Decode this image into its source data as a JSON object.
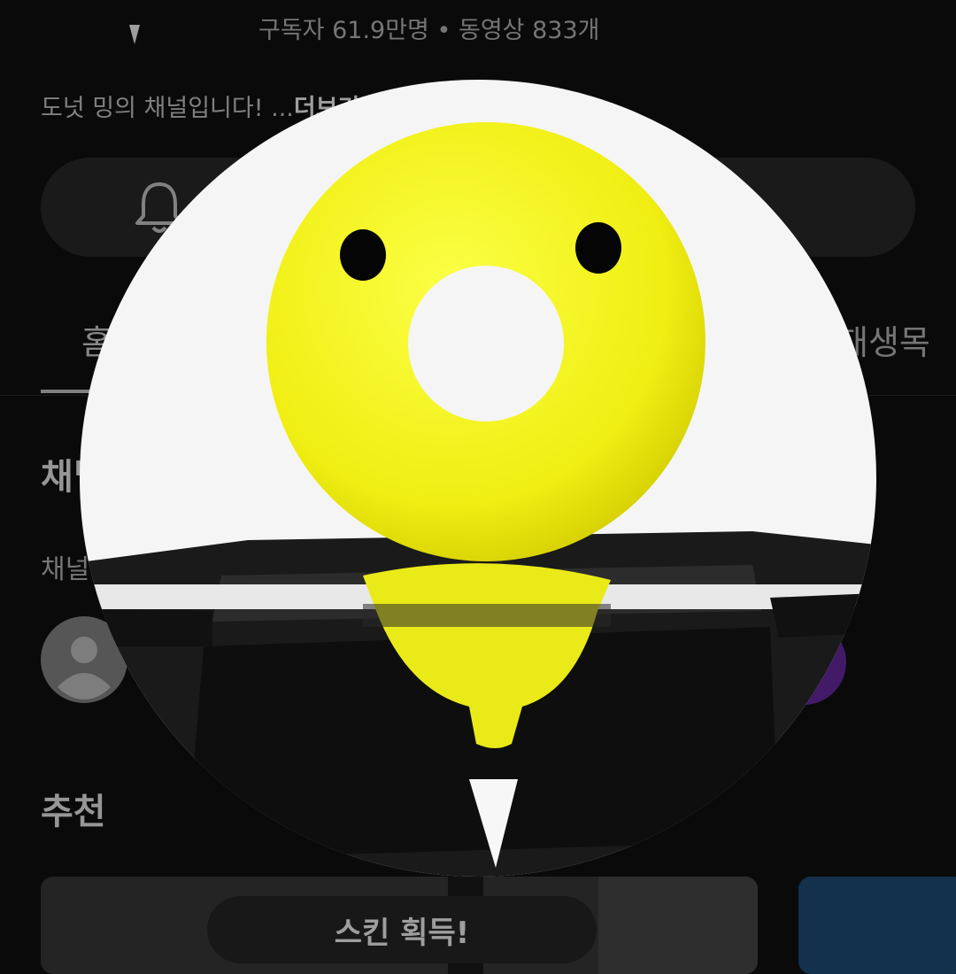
{
  "header": {
    "stats": "구독자 61.9만명 • 동영상 833개",
    "description": "도넛 밍의 채널입니다! ...",
    "more_label": "더보기"
  },
  "tabs": {
    "home": "홈",
    "playlist": "재생목록"
  },
  "sections": {
    "channel_title": "채널",
    "channel_subtitle": "채널 멤버",
    "recommended_title": "추천"
  },
  "video_card": {
    "badge": "스킨 획득!"
  },
  "icons": {
    "bell": "bell-icon",
    "avatar": "person-avatar-icon"
  },
  "colors": {
    "background": "#0a0a0a",
    "donut": "#f4f41a",
    "profile_bg": "#f5f5f5"
  }
}
